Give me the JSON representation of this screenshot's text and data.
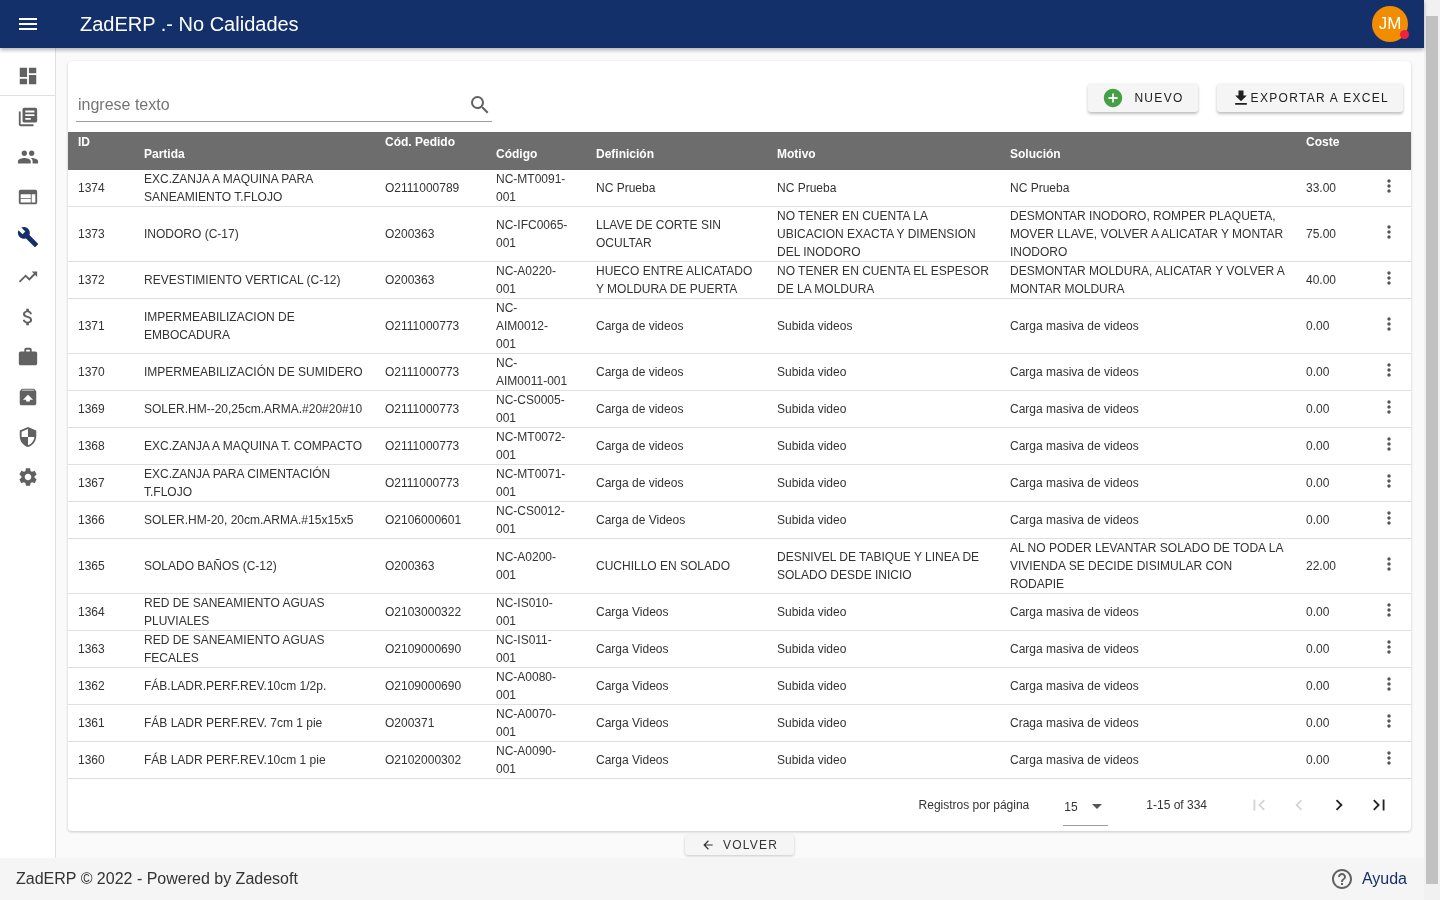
{
  "app_bar": {
    "title": "ZadERP .- No Calidades",
    "avatar": {
      "initials": "JM",
      "notification": true
    }
  },
  "sidebar": {
    "items": [
      {
        "selected": false
      },
      {
        "selected": false
      },
      {
        "selected": false
      },
      {
        "selected": false
      },
      {
        "selected": true
      },
      {
        "selected": false
      },
      {
        "selected": false
      },
      {
        "selected": false
      },
      {
        "selected": false
      },
      {
        "selected": false
      },
      {
        "selected": false
      }
    ]
  },
  "search": {
    "placeholder": "ingrese texto"
  },
  "buttons": [
    {
      "kind": "add",
      "label": "NUEVO"
    },
    {
      "kind": "export",
      "label": "EXPORTAR A EXCEL"
    }
  ],
  "table": {
    "columns": [
      "ID",
      "Partida",
      "Cód. Pedido",
      "Código",
      "Definición",
      "Motivo",
      "Solución",
      "Coste"
    ],
    "rows": [
      [
        "1374",
        "EXC.ZANJA A MAQUINA PARA SANEAMIENTO T.FLOJO",
        "O2111000789",
        "NC-MT0091-001",
        "NC Prueba",
        "NC Prueba",
        "NC Prueba",
        "33.00"
      ],
      [
        "1373",
        "INODORO (C-17)",
        "O200363",
        "NC-IFC0065-001",
        "LLAVE DE CORTE SIN OCULTAR",
        "NO TENER EN CUENTA LA UBICACION EXACTA Y DIMENSION DEL INODORO",
        "DESMONTAR INODORO, ROMPER PLAQUETA, MOVER LLAVE, VOLVER A ALICATAR Y MONTAR INODORO",
        "75.00"
      ],
      [
        "1372",
        "REVESTIMIENTO VERTICAL (C-12)",
        "O200363",
        "NC-A0220-001",
        "HUECO ENTRE ALICATADO Y MOLDURA DE PUERTA",
        "NO TENER EN CUENTA EL ESPESOR DE LA MOLDURA",
        "DESMONTAR MOLDURA, ALICATAR Y VOLVER A MONTAR MOLDURA",
        "40.00"
      ],
      [
        "1371",
        "IMPERMEABILIZACION DE EMBOCADURA",
        "O2111000773",
        "NC-AIM0012-001",
        "Carga de videos",
        "Subida videos",
        "Carga masiva de videos",
        "0.00"
      ],
      [
        "1370",
        "IMPERMEABILIZACIÓN DE SUMIDERO",
        "O2111000773",
        "NC-AIM0011-001",
        "Carga de videos",
        "Subida video",
        "Carga masiva de videos",
        "0.00"
      ],
      [
        "1369",
        "SOLER.HM--20,25cm.ARMA.#20#20#10",
        "O2111000773",
        "NC-CS0005-001",
        "Carga de videos",
        "Subida video",
        "Carga masiva de videos",
        "0.00"
      ],
      [
        "1368",
        "EXC.ZANJA A MAQUINA T. COMPACTO",
        "O2111000773",
        "NC-MT0072-001",
        "Carga de videos",
        "Subida video",
        "Carga masiva de videos",
        "0.00"
      ],
      [
        "1367",
        "EXC.ZANJA PARA CIMENTACIÓN T.FLOJO",
        "O2111000773",
        "NC-MT0071-001",
        "Carga de videos",
        "Subida video",
        "Carga masiva de videos",
        "0.00"
      ],
      [
        "1366",
        "SOLER.HM-20, 20cm.ARMA.#15x15x5",
        "O2106000601",
        "NC-CS0012-001",
        "Carga de Videos",
        "Subida video",
        "Carga masiva de videos",
        "0.00"
      ],
      [
        "1365",
        "SOLADO BAÑOS (C-12)",
        "O200363",
        "NC-A0200-001",
        "CUCHILLO EN SOLADO",
        "DESNIVEL DE TABIQUE Y LINEA DE SOLADO DESDE INICIO",
        "AL NO PODER LEVANTAR SOLADO DE TODA LA VIVIENDA SE DECIDE DISIMULAR CON RODAPIE",
        "22.00"
      ],
      [
        "1364",
        "RED DE SANEAMIENTO AGUAS PLUVIALES",
        "O2103000322",
        "NC-IS010-001",
        "Carga Videos",
        "Subida video",
        "Carga masiva de videos",
        "0.00"
      ],
      [
        "1363",
        "RED DE SANEAMIENTO AGUAS FECALES",
        "O2109000690",
        "NC-IS011-001",
        "Carga Videos",
        "Subida video",
        "Carga masiva de videos",
        "0.00"
      ],
      [
        "1362",
        "FÁB.LADR.PERF.REV.10cm 1/2p.",
        "O2109000690",
        "NC-A0080-001",
        "Carga Videos",
        "Subida video",
        "Carga masiva de videos",
        "0.00"
      ],
      [
        "1361",
        "FÁB LADR PERF.REV. 7cm 1 pie",
        "O200371",
        "NC-A0070-001",
        "Carga Videos",
        "Subida video",
        "Craga masiva de videos",
        "0.00"
      ],
      [
        "1360",
        "FÁB LADR PERF.REV.10cm 1 pie",
        "O2102000302",
        "NC-A0090-001",
        "Carga Videos",
        "Subida video",
        "Carga masiva de videos",
        "0.00"
      ]
    ]
  },
  "pagination": {
    "label": "Registros por página",
    "per_page": "15",
    "range": "1-15 of 334",
    "nav": [
      {
        "kind": "first",
        "disabled": true
      },
      {
        "kind": "prev",
        "disabled": true
      },
      {
        "kind": "next",
        "disabled": false
      },
      {
        "kind": "last",
        "disabled": false
      }
    ]
  },
  "back_button": {
    "label": "VOLVER"
  },
  "footer": {
    "text": "ZadERP © 2022 - Powered by Zadesoft",
    "help": "Ayuda"
  }
}
